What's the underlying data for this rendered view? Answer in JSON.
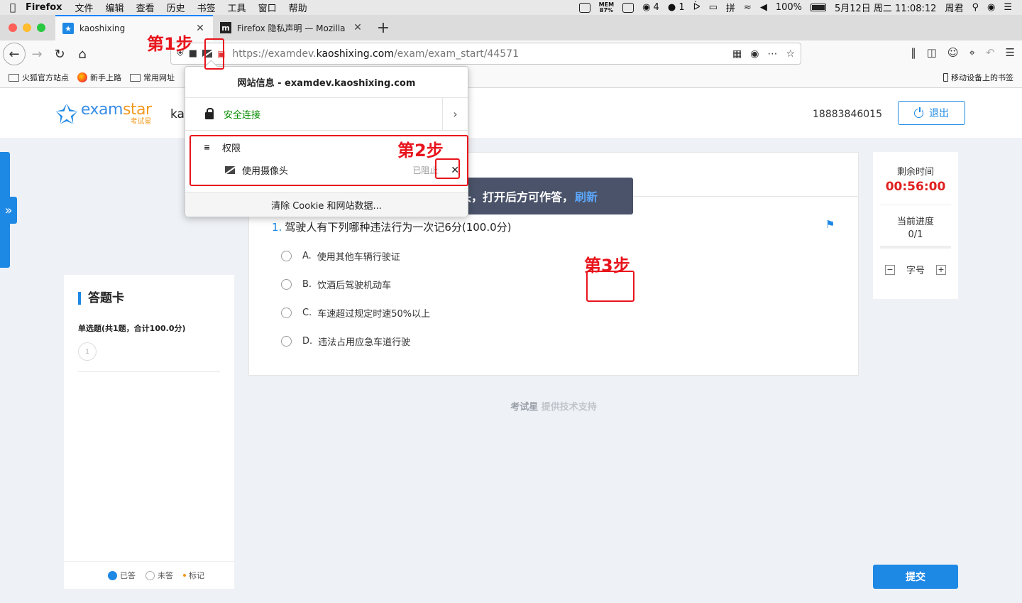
{
  "menubar": {
    "app": "Firefox",
    "items": [
      "文件",
      "编辑",
      "查看",
      "历史",
      "书签",
      "工具",
      "窗口",
      "帮助"
    ],
    "mem": "MEM",
    "mem_pct": "87%",
    "count1": "4",
    "count2": "1",
    "battery": "100%",
    "datetime": "5月12日 周二 11:08:12",
    "user": "周君"
  },
  "tabs": [
    {
      "title": "kaoshixing",
      "active": true
    },
    {
      "title": "Firefox 隐私声明 — Mozilla",
      "active": false
    }
  ],
  "navbar": {
    "url_prefix": "https://examdev.",
    "url_domain": "kaoshixing.com",
    "url_path": "/exam/exam_start/44571"
  },
  "bookmarks": {
    "items": [
      "火狐官方站点",
      "新手上路",
      "常用网址"
    ],
    "mobile": "移动设备上的书签"
  },
  "header": {
    "logo_en_1": "exam",
    "logo_en_2": "star",
    "logo_cn": "考试星",
    "site_name": "ka",
    "phone": "18883846015",
    "logout": "退出"
  },
  "answer_card": {
    "title": "答题卡",
    "section": "单选题(共1题，合计100.0分)",
    "numbers": [
      "1"
    ],
    "legend": {
      "answered": "已答",
      "unanswered": "未答",
      "marked": "标记"
    }
  },
  "question": {
    "number": "1.",
    "text": "驾驶人有下列哪种违法行为一次记6分(100.0分)",
    "options": [
      {
        "label": "A.",
        "text": "使用其他车辆行驶证"
      },
      {
        "label": "B.",
        "text": "饮酒后驾驶机动车"
      },
      {
        "label": "C.",
        "text": "车速超过规定时速50%以上"
      },
      {
        "label": "D.",
        "text": "违法占用应急车道行驶"
      }
    ]
  },
  "credit": {
    "brand": "考试星",
    "suffix": " 提供技术支持"
  },
  "timer": {
    "remaining_label": "剩余时间",
    "remaining": "00:56:00",
    "progress_label": "当前进度",
    "progress": "0/1",
    "progress_fraction": 0,
    "font_label": "字号",
    "minus": "−",
    "plus": "+"
  },
  "submit": "提交",
  "toast": {
    "message": "请打开摄像头，打开后方可作答，",
    "refresh": "刷新"
  },
  "identity_popup": {
    "title": "网站信息 - examdev.kaoshixing.com",
    "secure": "安全连接",
    "permissions": "权限",
    "camera": "使用摄像头",
    "blocked": "已阻止",
    "clear": "清除 Cookie 和网站数据..."
  },
  "annotations": {
    "step1": "第1步",
    "step2": "第2步",
    "step3": "第3步"
  },
  "colors": {
    "accent": "#1e88e5",
    "annotation": "#e8141c",
    "timer": "#e02020",
    "secure": "#058b00"
  }
}
